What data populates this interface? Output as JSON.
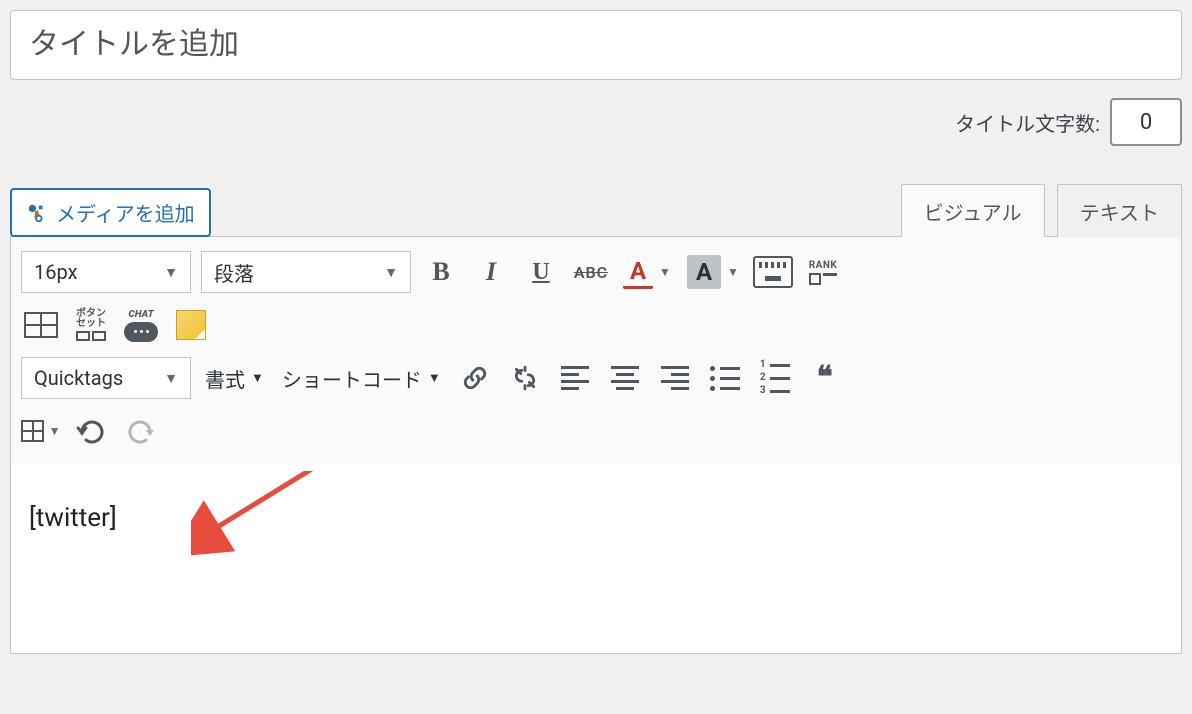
{
  "title": {
    "placeholder": "タイトルを追加",
    "value": ""
  },
  "titleCount": {
    "label": "タイトル文字数:",
    "value": "0"
  },
  "mediaButton": "メディアを追加",
  "tabs": {
    "visual": "ビジュアル",
    "text": "テキスト"
  },
  "toolbar": {
    "fontsize": "16px",
    "paragraph": "段落",
    "bold": "B",
    "italic": "I",
    "underline": "U",
    "strike": "ABC",
    "textColorLetter": "A",
    "bgColorLetter": "A",
    "rankLabel": "RANK",
    "btnsetLabel": "ボタン\nセット",
    "chatLabel": "CHAT",
    "quicktags": "Quicktags",
    "format": "書式",
    "shortcode": "ショートコード",
    "quote": "❝"
  },
  "content": {
    "body": "[twitter]"
  }
}
